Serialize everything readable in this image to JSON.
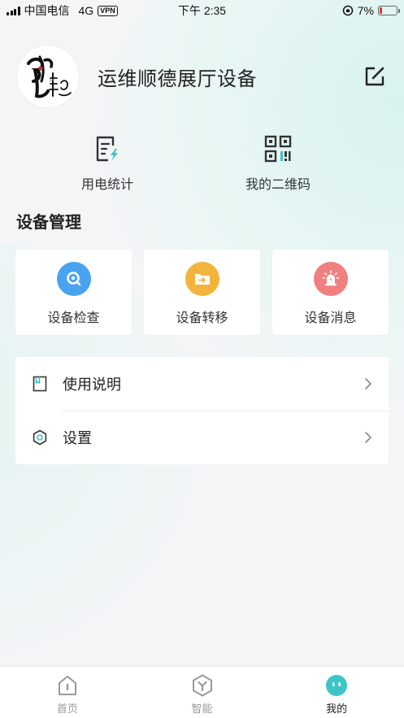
{
  "status_bar": {
    "carrier": "中国电信",
    "network": "4G",
    "vpn": "VPN",
    "time": "下午 2:35",
    "battery_pct": "7%"
  },
  "profile": {
    "name": "运维顺德展厅设备",
    "avatar_icon": "calligraphy-logo",
    "edit_icon": "edit-icon"
  },
  "quick_actions": [
    {
      "label": "用电统计",
      "icon": "power-stats-icon"
    },
    {
      "label": "我的二维码",
      "icon": "qr-code-icon"
    }
  ],
  "device_section": {
    "title": "设备管理",
    "cards": [
      {
        "label": "设备检查",
        "icon": "device-check-icon",
        "color": "#4aa3f0"
      },
      {
        "label": "设备转移",
        "icon": "device-transfer-icon",
        "color": "#f3b43d"
      },
      {
        "label": "设备消息",
        "icon": "device-message-icon",
        "color": "#f07f7f"
      }
    ]
  },
  "menu": [
    {
      "label": "使用说明",
      "icon": "manual-icon"
    },
    {
      "label": "设置",
      "icon": "settings-icon"
    }
  ],
  "tabbar": [
    {
      "label": "首页",
      "icon": "home-icon",
      "active": false
    },
    {
      "label": "智能",
      "icon": "smart-icon",
      "active": false
    },
    {
      "label": "我的",
      "icon": "profile-face-icon",
      "active": true
    }
  ],
  "colors": {
    "accent": "#3cc4c7",
    "background": "#f3f5f7"
  }
}
